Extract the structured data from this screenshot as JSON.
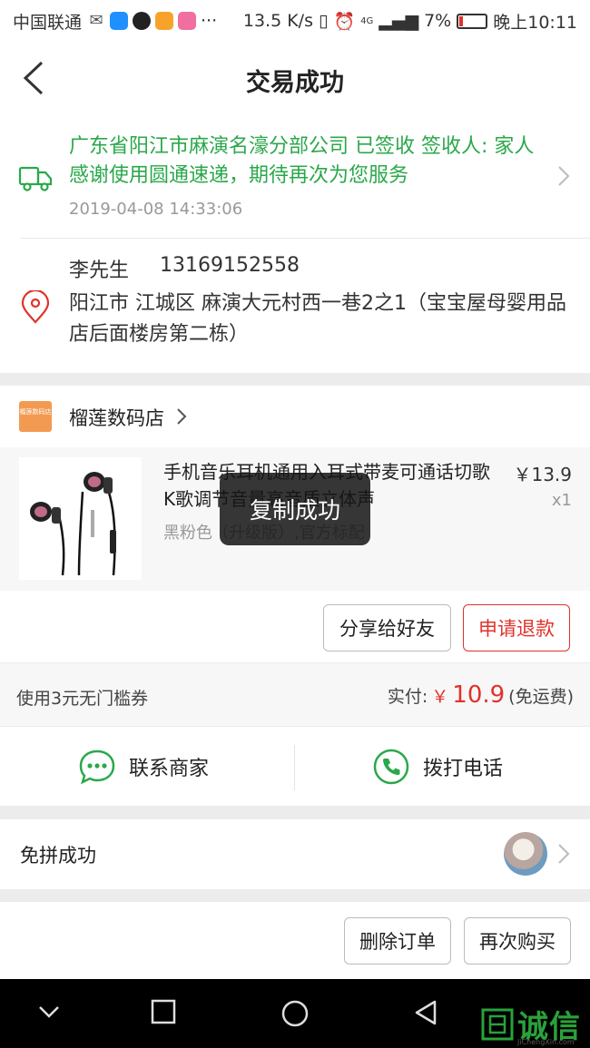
{
  "status_bar": {
    "carrier": "中国联通",
    "more": "···",
    "speed": "13.5 K/s",
    "signal_label": "4G",
    "battery": "7%",
    "time": "晚上10:11"
  },
  "header": {
    "title": "交易成功"
  },
  "logistics": {
    "text": "广东省阳江市麻演名濠分部公司 已签收 签收人: 家人 感谢使用圆通速递，期待再次为您服务",
    "time": "2019-04-08 14:33:06"
  },
  "address": {
    "name": "李先生",
    "phone": "13169152558",
    "line": "阳江市 江城区 麻演大元村西一巷2之1（宝宝屋母婴用品店后面楼房第二栋）"
  },
  "shop": {
    "logo_text": "榴莲数码店",
    "name": "榴莲数码店"
  },
  "goods": {
    "title": "手机音乐耳机通用入耳式带麦可通话切歌K歌调节音量高音质立体声",
    "spec": "黑粉色（升级版）,官方标配",
    "price": "￥13.9",
    "qty": "x1"
  },
  "actions": {
    "share": "分享给好友",
    "refund": "申请退款"
  },
  "payment": {
    "coupon": "使用3元无门槛券",
    "paid_label": "实付:",
    "currency": "￥",
    "amount": "10.9",
    "shipping": "(免运费)"
  },
  "contact": {
    "merchant": "联系商家",
    "call": "拨打电话"
  },
  "group": {
    "label": "免拼成功"
  },
  "bottom": {
    "delete": "删除订单",
    "rebuy": "再次购买"
  },
  "toast": {
    "text": "复制成功"
  },
  "watermark": {
    "text": "诚信",
    "sub": "JiChengXin.com"
  },
  "colors": {
    "accent_red": "#e0322b",
    "logistics_green": "#2aa84a",
    "wechat_green": "#2aa84a"
  }
}
